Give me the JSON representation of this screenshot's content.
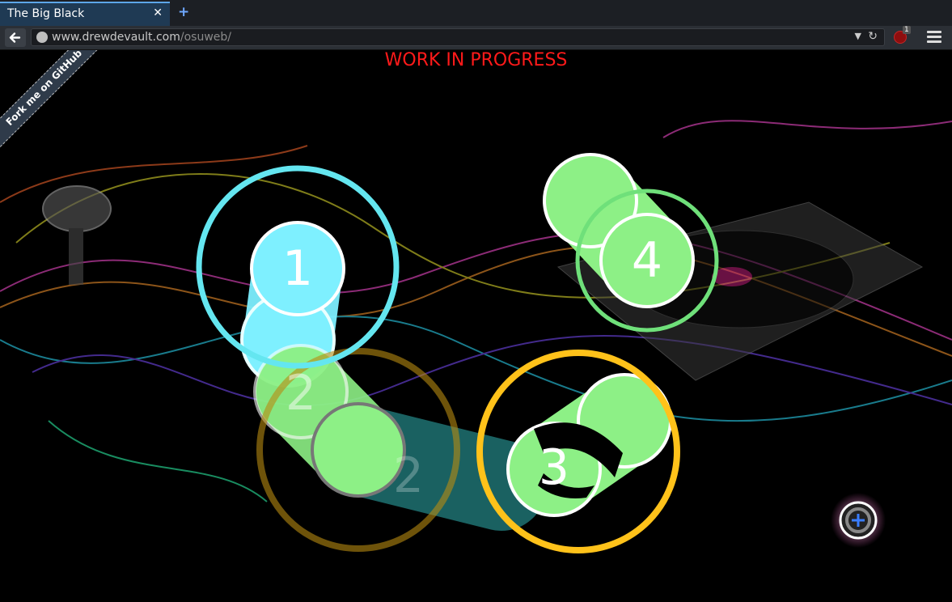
{
  "browser": {
    "tab": {
      "title": "The Big Black",
      "close_glyph": "✕"
    },
    "new_tab_glyph": "+",
    "url": {
      "domain": "www.drewdevault.com",
      "path": "/osuweb/"
    },
    "addon_badge": "1"
  },
  "page": {
    "banner": "WORK IN PROGRESS",
    "ribbon": "Fork me on GitHub",
    "hit_circles": [
      {
        "number": "1",
        "color": "#7ef0ff"
      },
      {
        "number": "2",
        "color": "#8df086"
      },
      {
        "number": "3",
        "color": "#8df086"
      },
      {
        "number": "4",
        "color": "#8df086"
      }
    ],
    "colors": {
      "banner": "#ff1a1a",
      "approach_cyan": "#64e6f0",
      "approach_yellow": "#ffc21a",
      "approach_green": "#6fe07a"
    }
  }
}
